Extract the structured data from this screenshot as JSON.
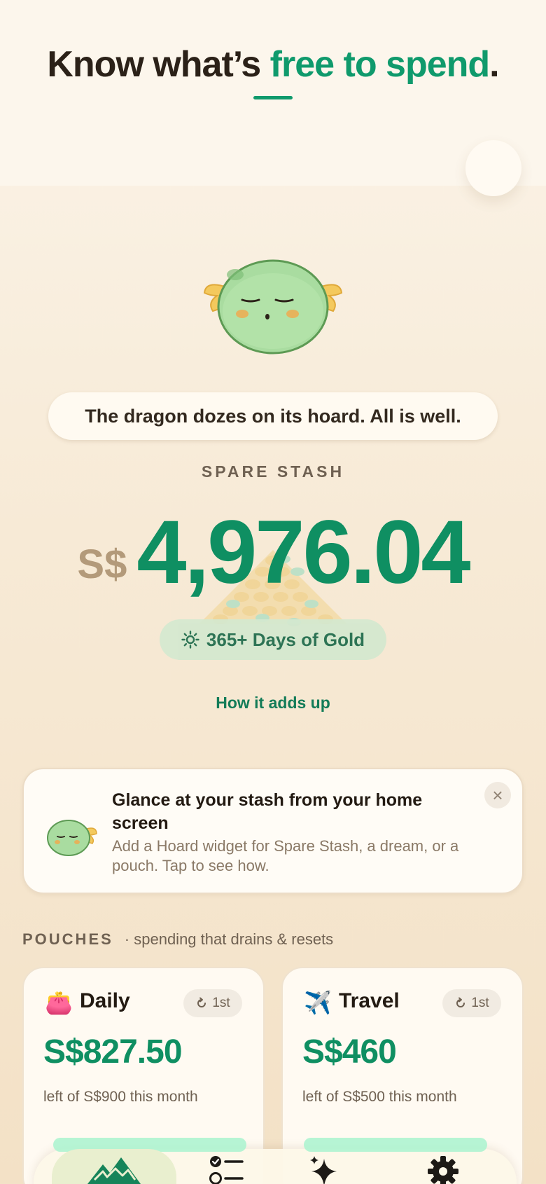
{
  "header": {
    "headline_before": "Know what’s ",
    "headline_accent": "free to spend",
    "headline_after": "."
  },
  "hero": {
    "status_message": "The dragon dozes on its hoard. All is well.",
    "stash_label": "SPARE STASH",
    "currency": "S$",
    "amount": "4,976.04",
    "badge_icon": "sun-icon",
    "badge_text": "365+ Days of Gold",
    "link_text": "How it adds up"
  },
  "widget_promo": {
    "title": "Glance at your stash from your home screen",
    "subtitle": "Add a Hoard widget for Spare Stash, a dream, or a pouch. Tap to see how.",
    "close_glyph": "×"
  },
  "pouches": {
    "title": "POUCHES",
    "subtitle": "· spending that drains & resets",
    "items": [
      {
        "icon": "purse-icon",
        "icon_glyph": "👛",
        "name": "Daily",
        "reset_icon": "refresh-icon",
        "reset_label": "1st",
        "amount": "S$827.50",
        "detail": "left of S$900 this month"
      },
      {
        "icon": "airplane-icon",
        "icon_glyph": "✈️",
        "name": "Travel",
        "reset_icon": "refresh-icon",
        "reset_label": "1st",
        "amount": "S$460",
        "detail": "left of S$500 this month"
      }
    ]
  },
  "bottom_nav": {
    "items": [
      {
        "name": "home",
        "icon": "mountains-icon",
        "active": true
      },
      {
        "name": "tasks",
        "icon": "checklist-icon",
        "active": false
      },
      {
        "name": "insights",
        "icon": "sparkle-icon",
        "active": false
      },
      {
        "name": "settings",
        "icon": "gear-icon",
        "active": false
      }
    ]
  },
  "colors": {
    "accent_green": "#0f8f62",
    "background": "#f7ead6",
    "muted_text": "#6f6152",
    "currency_prefix": "#b39a7a"
  }
}
